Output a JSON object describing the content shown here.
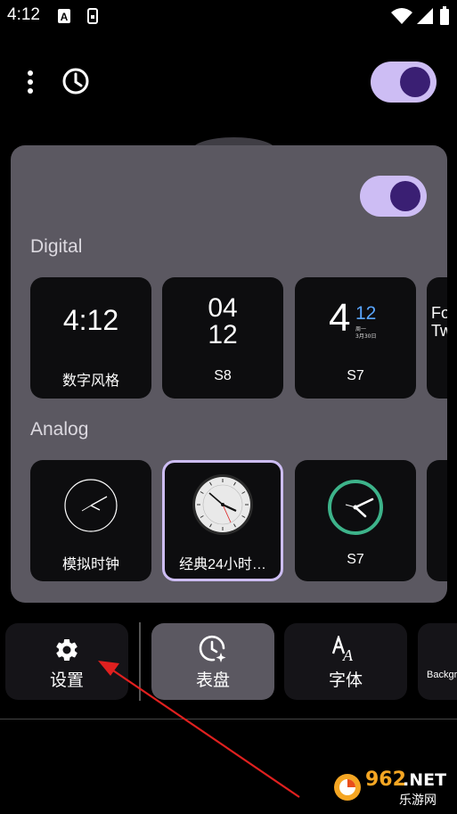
{
  "status_bar": {
    "time": "4:12",
    "icons": [
      "a-notification-icon",
      "sim-notification-icon",
      "wifi-icon",
      "signal-icon",
      "battery-icon"
    ]
  },
  "top_bar": {
    "icons": [
      "more-vert-icon",
      "clock-history-icon"
    ],
    "master_toggle_on": true
  },
  "panel": {
    "toggle_on": true,
    "sections": {
      "digital": {
        "title": "Digital",
        "cards": [
          {
            "label": "数字风格",
            "display": "4:12"
          },
          {
            "label": "S8",
            "display_top": "04",
            "display_bottom": "12"
          },
          {
            "label": "S7",
            "big_digit": "4",
            "small_digits": "12",
            "tiny_line1": "周一",
            "tiny_line2": "3月30日"
          },
          {
            "label": "",
            "partial_line1": "Fo",
            "partial_line2": "Tw"
          }
        ]
      },
      "analog": {
        "title": "Analog",
        "cards": [
          {
            "label": "模拟时钟"
          },
          {
            "label": "经典24小时…",
            "selected": true
          },
          {
            "label": "S7"
          },
          {
            "label": ""
          }
        ]
      }
    }
  },
  "bottom_tabs": [
    {
      "label": "设置",
      "icon": "gear-icon"
    },
    {
      "label": "表盘",
      "icon": "watch-face-icon",
      "active": true
    },
    {
      "label": "字体",
      "icon": "font-icon"
    },
    {
      "label": "Backgr",
      "icon": ""
    }
  ],
  "colors": {
    "toggle_track": "#cdbdf4",
    "toggle_knob": "#3a1f73",
    "panel_bg": "#5b5861",
    "selected_border": "#cdbdf4",
    "accent_blue": "#5aa6ff",
    "accent_green": "#3db38a",
    "arrow_red": "#e0201f"
  },
  "watermark": {
    "brand": "962",
    "suffix": ".NET",
    "caption": "乐游网"
  }
}
